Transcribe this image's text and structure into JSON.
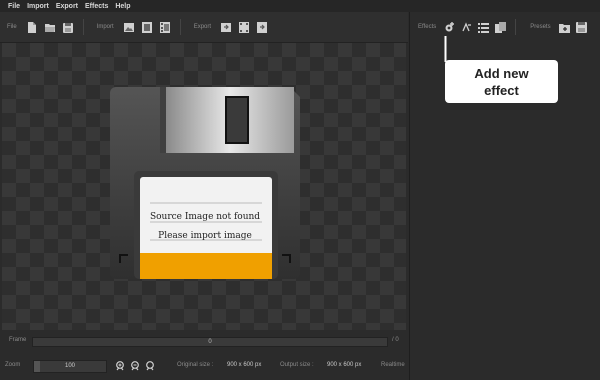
{
  "menu": [
    "File",
    "Import",
    "Export",
    "Effects",
    "Help"
  ],
  "toolbar": {
    "file_label": "File",
    "import_label": "Import",
    "export_label": "Export"
  },
  "right_toolbar": {
    "effects_label": "Effects",
    "presets_label": "Presets"
  },
  "tooltip": {
    "line1": "Add new",
    "line2": "effect"
  },
  "floppy_label": {
    "line1": "Source Image not found",
    "line2": "Please import image"
  },
  "frame": {
    "label": "Frame",
    "value": "0",
    "total": "/ 0"
  },
  "status": {
    "zoom_label": "Zoom",
    "zoom_value": "100",
    "original_size_label": "Original size :",
    "original_size_value": "900 x 600 px",
    "output_size_label": "Output size :",
    "output_size_value": "900 x 600 px",
    "realtime_label": "Realtime"
  },
  "colors": {
    "accent_orange": "#f0a000",
    "background": "#2b2b2b"
  }
}
